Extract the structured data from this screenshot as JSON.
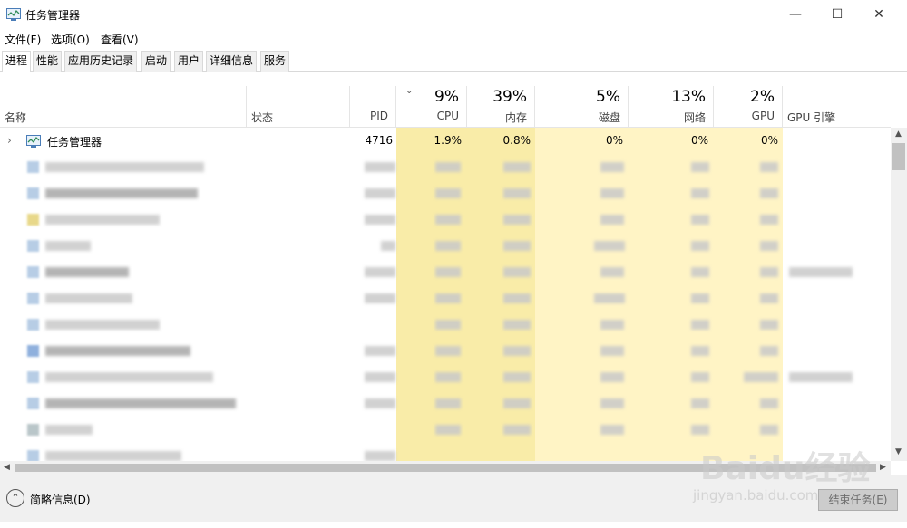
{
  "window": {
    "title": "任务管理器"
  },
  "menu": [
    "文件(F)",
    "选项(O)",
    "查看(V)"
  ],
  "tabs": [
    "进程",
    "性能",
    "应用历史记录",
    "启动",
    "用户",
    "详细信息",
    "服务"
  ],
  "columns": {
    "name": "名称",
    "status": "状态",
    "pid": "PID",
    "cpu": {
      "pct": "9%",
      "label": "CPU"
    },
    "memory": {
      "pct": "39%",
      "label": "内存"
    },
    "disk": {
      "pct": "5%",
      "label": "磁盘"
    },
    "network": {
      "pct": "13%",
      "label": "网络"
    },
    "gpu": {
      "pct": "2%",
      "label": "GPU"
    },
    "gpu_engine": "GPU 引擎"
  },
  "first_row": {
    "name": "任务管理器",
    "pid": "4716",
    "cpu": "1.9%",
    "memory": "0.8%",
    "disk": "0%",
    "network": "0%",
    "gpu": "0%"
  },
  "footer": {
    "fewer_details": "简略信息(D)",
    "end_task": "结束任务(E)"
  },
  "watermark": {
    "logo": "Baidu经验",
    "url": "jingyan.baidu.com"
  },
  "colors": {
    "cpu_highlight": "#f9eca8",
    "light_highlight": "#fff4c5"
  }
}
